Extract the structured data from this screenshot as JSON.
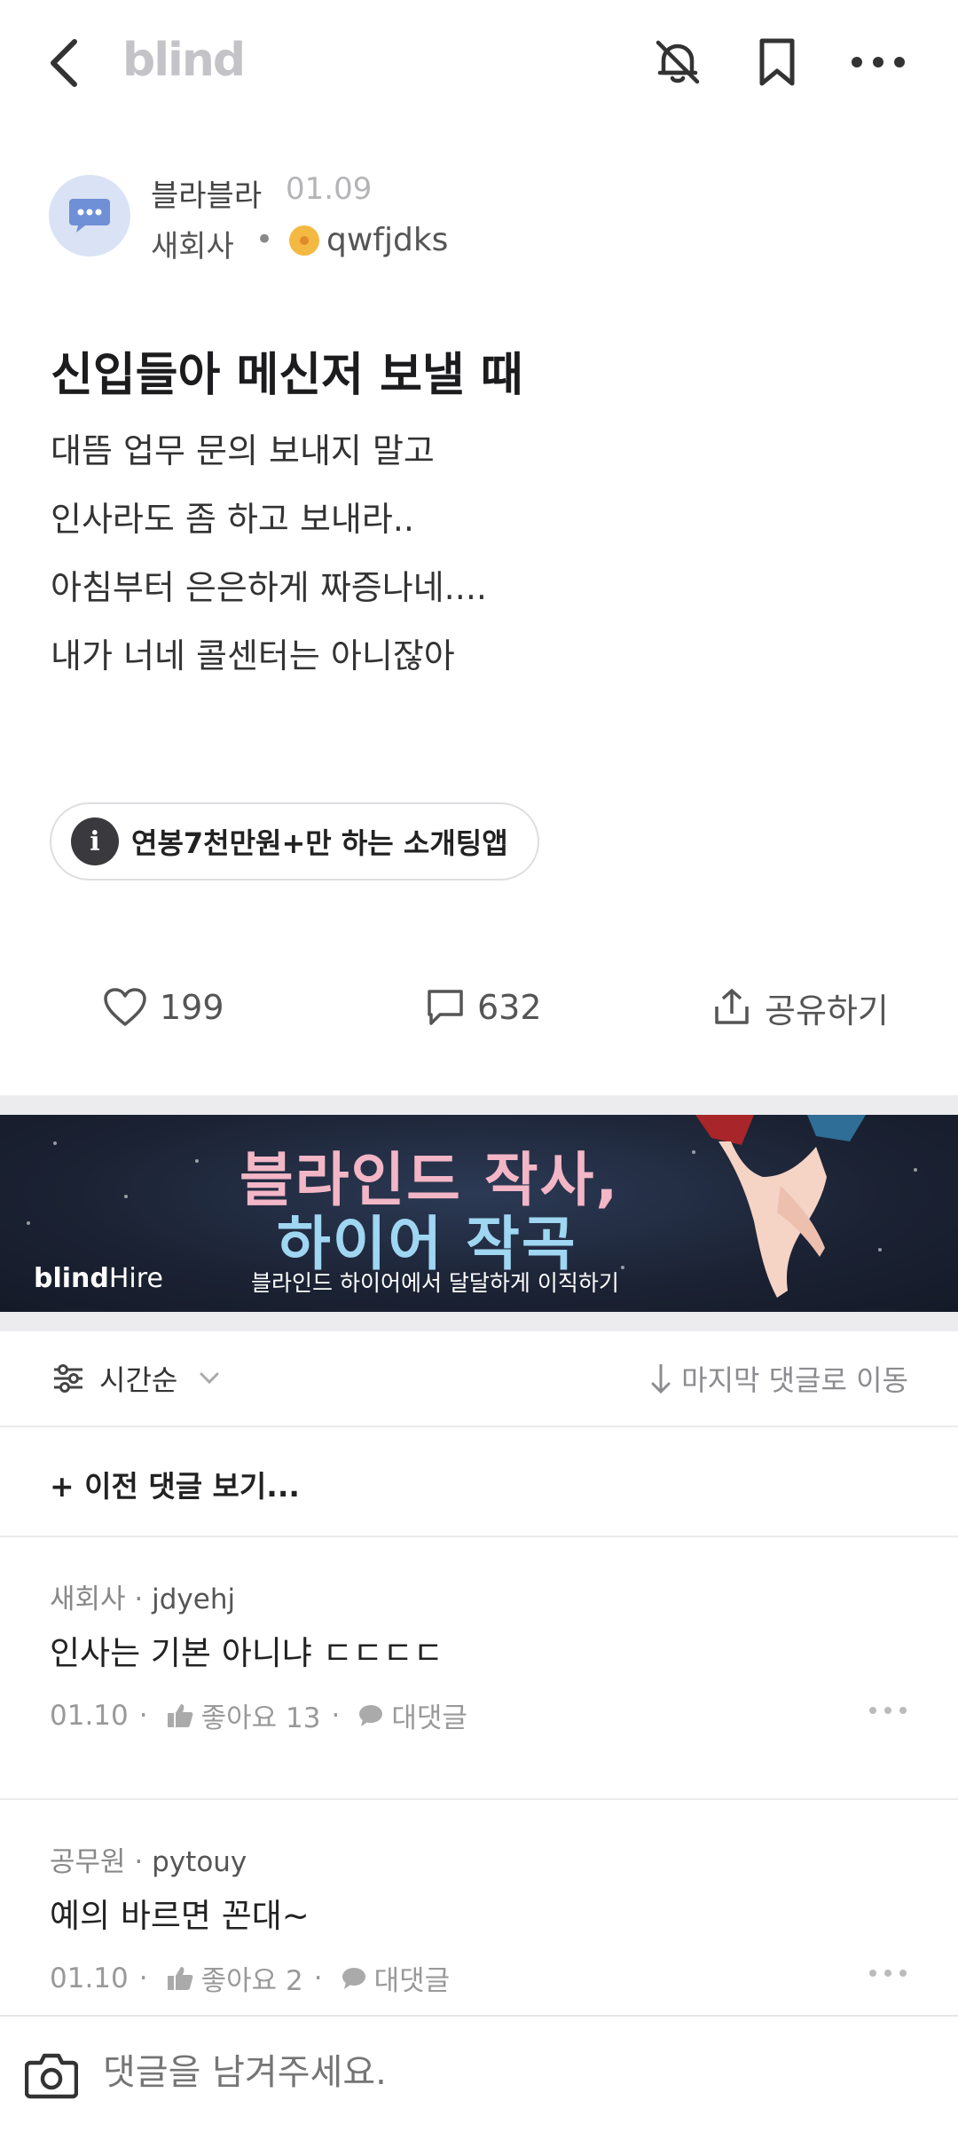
{
  "header": {
    "logo": "blind"
  },
  "post": {
    "author_name": "블라블라",
    "date": "01.09",
    "company": "새회사",
    "separator": "•",
    "handle": "qwfjdks",
    "title": "신입들아 메신저 보낼 때",
    "body_lines": [
      "대뜸 업무 문의 보내지 말고",
      "인사라도 좀 하고 보내라..",
      "아침부터 은은하게 짜증나네....",
      "내가 너네 콜센터는 아니잖아"
    ],
    "info_pill": "연봉7천만원+만 하는 소개팅앱",
    "info_icon_glyph": "i",
    "likes": "199",
    "comments": "632",
    "share_label": "공유하기"
  },
  "banner": {
    "line1": "블라인드 작사,",
    "line2": "하이어 작곡",
    "logo_bold": "blind",
    "logo_light": "Hire",
    "subtitle": "블라인드 하이어에서 달달하게 이직하기"
  },
  "sort": {
    "label": "시간순",
    "jump_label": "마지막 댓글로 이동"
  },
  "prev_comments": {
    "label": "+  이전 댓글 보기..."
  },
  "comments": [
    {
      "company": "새회사",
      "handle": "jdyehj",
      "text": "인사는 기본 아니냐 ㄷㄷㄷㄷ",
      "date": "01.10",
      "likes_label": "좋아요 13",
      "reply_label": "대댓글"
    },
    {
      "company": "공무원",
      "handle": "pytouy",
      "text": "예의 바르면 꼰대~",
      "date": "01.10",
      "likes_label": "좋아요 2",
      "reply_label": "대댓글"
    }
  ],
  "composer": {
    "placeholder": "댓글을 남겨주세요."
  },
  "colors": {
    "accent_avatar": "#d9e3f5",
    "badge": "#f4b942",
    "banner_bg": "#1b2233",
    "banner_pink": "#f3b6c6",
    "banner_blue": "#9fd6f2"
  },
  "icons": [
    "back-icon",
    "bell-off-icon",
    "bookmark-icon",
    "more-icon",
    "chat-bubble-icon",
    "heart-icon",
    "comment-icon",
    "share-icon",
    "filter-icon",
    "chevron-down-icon",
    "arrow-down-icon",
    "thumb-up-icon",
    "reply-bubble-icon",
    "camera-icon"
  ]
}
